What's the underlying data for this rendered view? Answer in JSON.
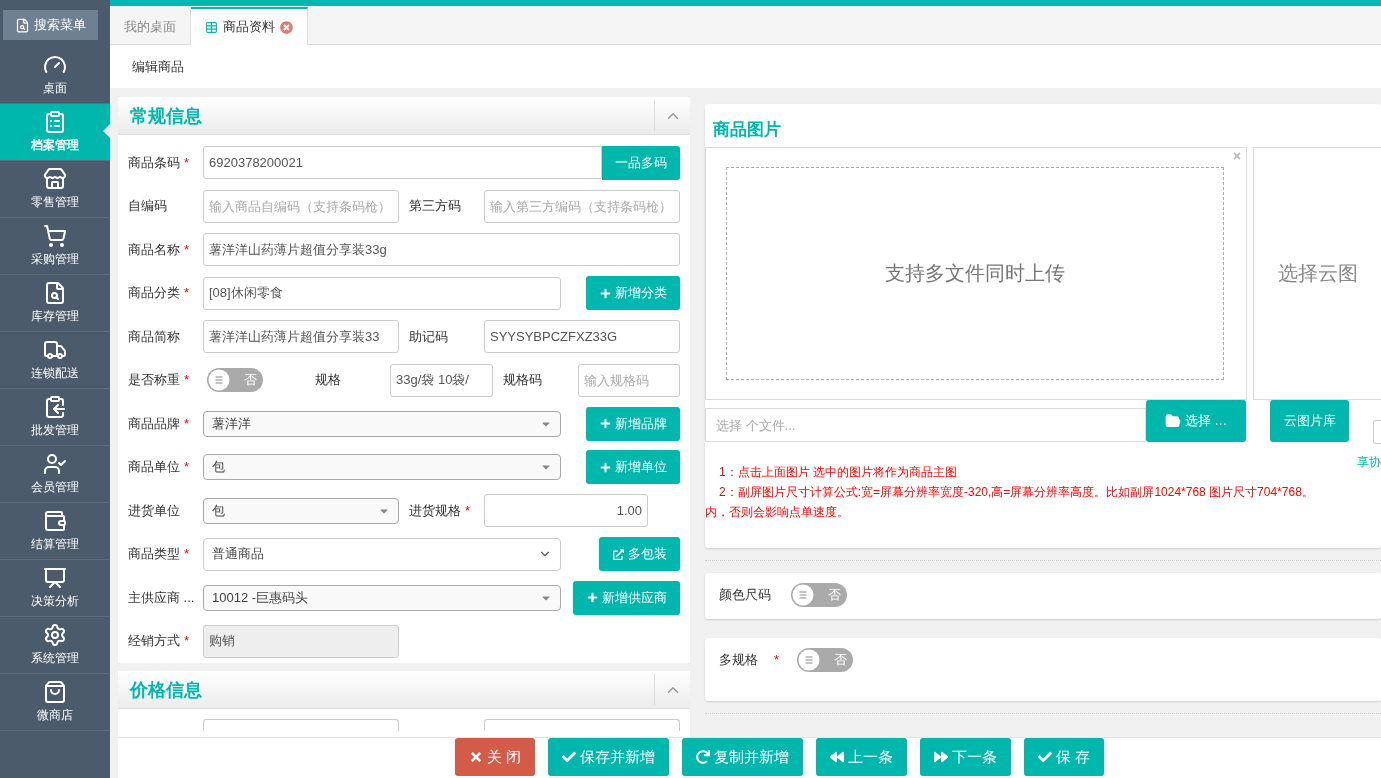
{
  "sidebar": {
    "search": "搜索菜单",
    "items": [
      {
        "label": "桌面",
        "selected": false
      },
      {
        "label": "档案管理",
        "selected": true
      },
      {
        "label": "零售管理",
        "selected": false
      },
      {
        "label": "采购管理",
        "selected": false
      },
      {
        "label": "库存管理",
        "selected": false
      },
      {
        "label": "连锁配送",
        "selected": false
      },
      {
        "label": "批发管理",
        "selected": false
      },
      {
        "label": "会员管理",
        "selected": false
      },
      {
        "label": "结算管理",
        "selected": false
      },
      {
        "label": "决策分析",
        "selected": false
      },
      {
        "label": "系统管理",
        "selected": false
      },
      {
        "label": "微商店",
        "selected": false
      }
    ]
  },
  "tabs": [
    {
      "label": "我的桌面",
      "selected": false,
      "closable": false
    },
    {
      "label": "商品资料",
      "selected": true,
      "closable": true
    }
  ],
  "breadcrumb": "编辑商品",
  "general": {
    "title": "常规信息",
    "rows": [
      [
        {
          "kind": "label",
          "text": "商品条码",
          "asterisk": "*"
        },
        {
          "kind": "input",
          "value": "6920378200021"
        },
        {
          "kind": "addon",
          "text": "一品多码"
        }
      ],
      [
        {
          "kind": "label",
          "text": "自编码"
        },
        {
          "kind": "input",
          "placeholder": "输入商品自编码（支持条码枪）"
        },
        {
          "kind": "label",
          "text": "第三方码"
        },
        {
          "kind": "input",
          "placeholder": "输入第三方编码（支持条码枪）"
        }
      ],
      [
        {
          "kind": "label",
          "text": "商品名称",
          "asterisk": "*"
        },
        {
          "kind": "input",
          "value": "薯洋洋山药薄片超值分享装33g"
        }
      ],
      [
        {
          "kind": "label",
          "text": "商品分类",
          "asterisk": "*"
        },
        {
          "kind": "input",
          "value": "[08]休闲零食"
        },
        {
          "kind": "button",
          "text": "新增分类"
        }
      ],
      [
        {
          "kind": "label",
          "text": "商品简称"
        },
        {
          "kind": "input",
          "value": "薯洋洋山药薄片超值分享装33"
        },
        {
          "kind": "label",
          "text": "助记码"
        },
        {
          "kind": "input",
          "value": "SYYSYBPCZFXZ33G"
        }
      ],
      [
        {
          "kind": "label",
          "text": "是否称重",
          "asterisk": "*"
        },
        {
          "kind": "toggle",
          "on": false,
          "text": "否"
        },
        {
          "kind": "label",
          "text": "规格"
        },
        {
          "kind": "input",
          "value": "33g/袋 10袋/"
        },
        {
          "kind": "label",
          "text": "规格码"
        },
        {
          "kind": "input",
          "placeholder": "输入规格码"
        }
      ],
      [
        {
          "kind": "label",
          "text": "商品品牌",
          "asterisk": "*"
        },
        {
          "kind": "select",
          "value": "薯洋洋"
        },
        {
          "kind": "button",
          "text": "新增品牌"
        }
      ],
      [
        {
          "kind": "label",
          "text": "商品单位",
          "asterisk": "*"
        },
        {
          "kind": "select",
          "value": "包"
        },
        {
          "kind": "button",
          "text": "新增单位"
        }
      ],
      [
        {
          "kind": "label",
          "text": "进货单位"
        },
        {
          "kind": "select",
          "value": "包"
        },
        {
          "kind": "label",
          "text": "进货规格",
          "asterisk": "*"
        },
        {
          "kind": "number",
          "value": "1.00"
        }
      ],
      [
        {
          "kind": "label",
          "text": "商品类型",
          "asterisk": "*"
        },
        {
          "kind": "chevron-select",
          "value": "普通商品"
        },
        {
          "kind": "link-button",
          "text": "多包装"
        }
      ],
      [
        {
          "kind": "label",
          "text": "主供应商 ..."
        },
        {
          "kind": "select",
          "value": "10012 -巨惠码头"
        },
        {
          "kind": "button",
          "text": "新增供应商"
        }
      ],
      [
        {
          "kind": "label",
          "text": "经销方式",
          "asterisk": "*"
        },
        {
          "kind": "input",
          "value": "购销",
          "disabled": true
        }
      ]
    ]
  },
  "price": {
    "title": "价格信息"
  },
  "images": {
    "title": "商品图片",
    "upload_hint": "支持多文件同时上传",
    "cloud_hint": "选择云图",
    "file_placeholder": "选择 个文件...",
    "choose_button": "选择 …",
    "cloud_button": "云图片库",
    "side_text": "享协",
    "checkbox": {
      "checked": false
    },
    "notes": [
      "1：点击上面图片 选中的图片将作为商品主图",
      "2：副屏图片尺寸计算公式:宽=屏幕分辨率宽度-320,高=屏幕分辨率高度。比如副屏1024*768 图片尺寸704*768。",
      "内，否则会影响点单速度。"
    ]
  },
  "options": [
    {
      "label": "颜色尺码",
      "on": false,
      "text": "否"
    },
    {
      "label": "多规格",
      "asterisk": "*",
      "on": false,
      "text": "否"
    }
  ],
  "footer": [
    {
      "text": "关 闭",
      "kind": "danger"
    },
    {
      "text": "保存并新增",
      "kind": "primary"
    },
    {
      "text": "复制并新增",
      "kind": "primary"
    },
    {
      "text": "上一条",
      "kind": "primary"
    },
    {
      "text": "下一条",
      "kind": "primary"
    },
    {
      "text": "保 存",
      "kind": "primary"
    }
  ]
}
